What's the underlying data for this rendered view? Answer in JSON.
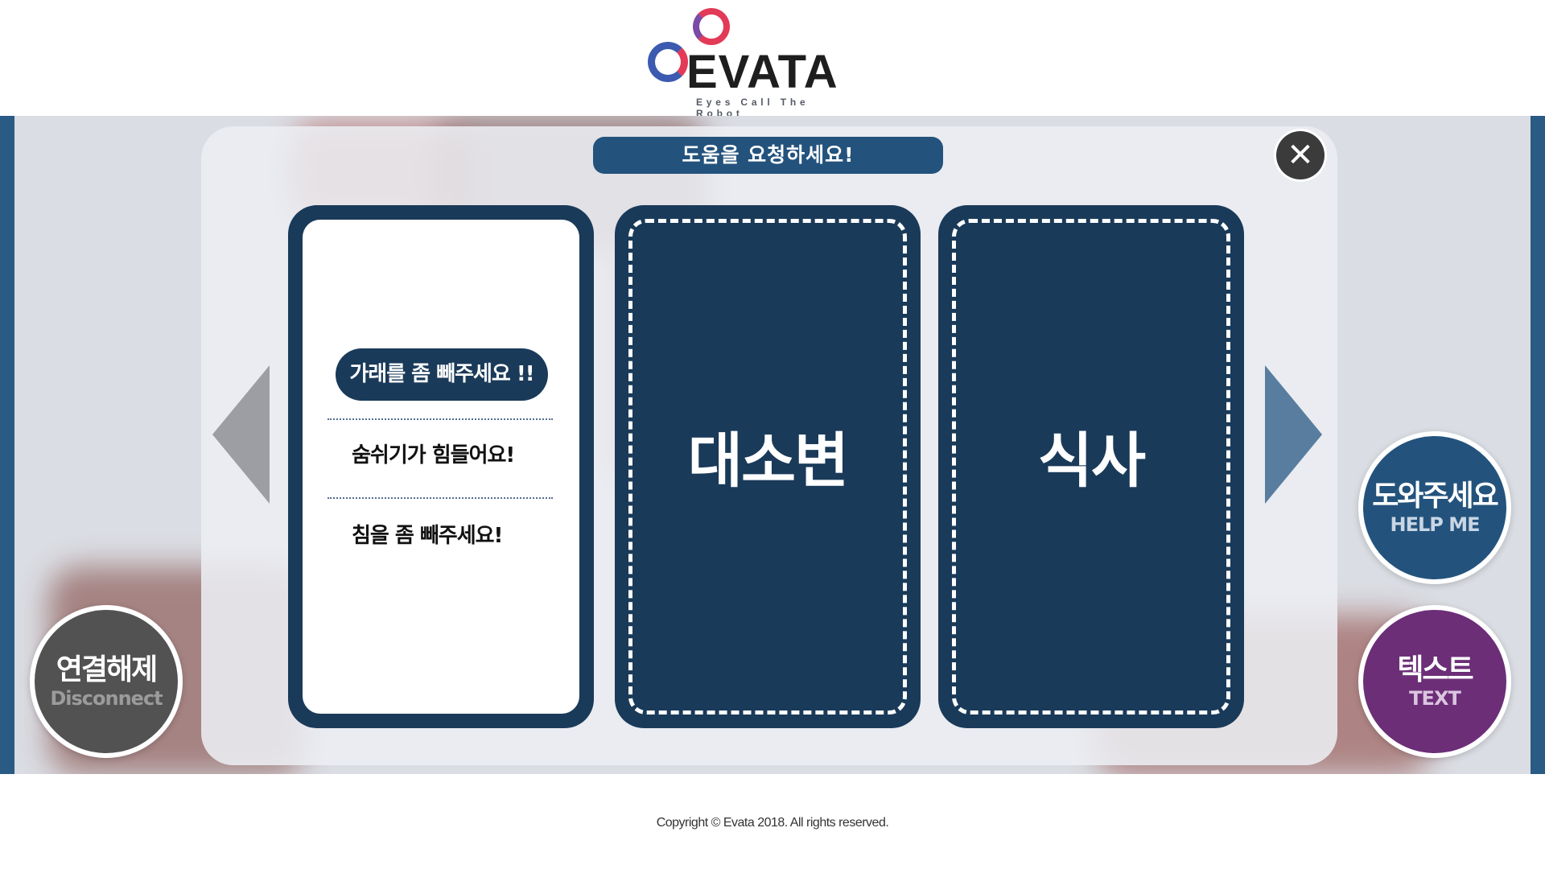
{
  "header": {
    "logo_word": "EVATA",
    "logo_tagline": "Eyes Call The Robot",
    "logo_icon": "evata-rings-logo"
  },
  "modal": {
    "title": "도움을 요청하세요!",
    "close_icon": "close-icon",
    "prev_icon": "arrow-left-icon",
    "next_icon": "arrow-right-icon",
    "phrases": [
      "가래를 좀 빼주세요 !!",
      "숨쉬기가 힘들어요!",
      "침을 좀 빼주세요!"
    ],
    "selected_phrase_index": 0,
    "categories": [
      "대소변",
      "식사"
    ]
  },
  "buttons": {
    "disconnect": {
      "main": "연결해제",
      "sub": "Disconnect",
      "color": "#525252"
    },
    "help": {
      "main": "도와주세요",
      "sub": "HELP ME",
      "color": "#23537d"
    },
    "text": {
      "main": "텍스트",
      "sub": "TEXT",
      "color": "#6b2e77"
    }
  },
  "theme": {
    "navy": "#1a3a59",
    "accent_blue": "#23537d",
    "accent_red": "#e23a57"
  },
  "footer": {
    "copyright": "Copyright © Evata 2018. All rights reserved."
  }
}
